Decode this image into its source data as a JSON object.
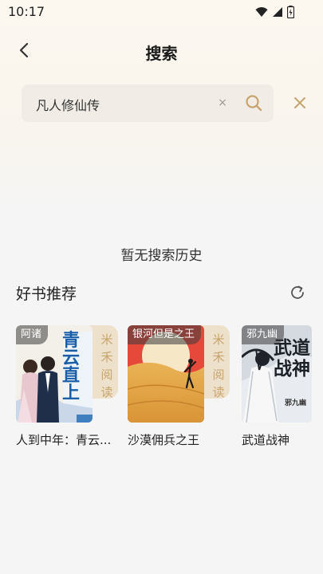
{
  "status_bar": {
    "time": "10:17"
  },
  "header": {
    "title": "搜索"
  },
  "search": {
    "query": "凡人修仙传",
    "clear_label": "×"
  },
  "history": {
    "empty_text": "暂无搜索历史"
  },
  "recommend": {
    "title": "好书推荐",
    "books": [
      {
        "title": "人到中年：青云...",
        "author": "阿诸",
        "tab_label": "米禾阅读",
        "cover_text": "青云直上",
        "cover_colors": [
          "#f3efe9",
          "#3f7fbf"
        ]
      },
      {
        "title": "沙漠佣兵之王",
        "author": "银河但是之王",
        "tab_label": "米禾阅读",
        "cover_colors": [
          "#e6483a",
          "#e9b355"
        ]
      },
      {
        "title": "武道战神",
        "author": "邪九幽",
        "cover_text": "武道战神",
        "cover_sub": "邪九幽",
        "cover_colors": [
          "#e8ebef",
          "#20242a"
        ]
      }
    ]
  },
  "colors": {
    "accent": "#c8a46e",
    "search_bg": "#f1ede6"
  }
}
